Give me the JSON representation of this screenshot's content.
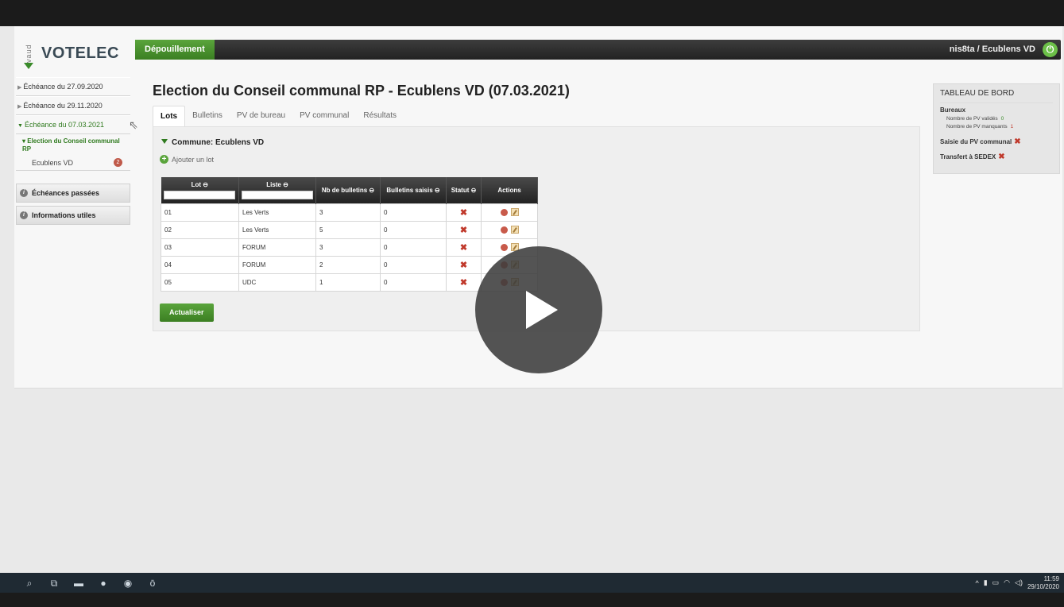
{
  "app": {
    "logo_text": "VOTELEC",
    "logo_sub": "vaud",
    "nav_tab": "Dépouillement",
    "user": "nis8ta  /  Ecublens VD",
    "power_icon": "power-icon"
  },
  "sidebar": {
    "echeances": [
      {
        "label": "Échéance du 27.09.2020"
      },
      {
        "label": "Échéance du 29.11.2020"
      },
      {
        "label": "Échéance du 07.03.2021"
      }
    ],
    "election": "Election du Conseil communal RP",
    "commune": "Ecublens VD",
    "commune_count": "2",
    "boxes": [
      {
        "label": "Échéances passées"
      },
      {
        "label": "Informations utiles"
      }
    ]
  },
  "main": {
    "title": "Election du Conseil communal RP - Ecublens VD (07.03.2021)",
    "tabs": [
      {
        "label": "Lots"
      },
      {
        "label": "Bulletins"
      },
      {
        "label": "PV de bureau"
      },
      {
        "label": "PV communal"
      },
      {
        "label": "Résultats"
      }
    ],
    "commune_header": "Commune: Ecublens VD",
    "add_lot": "Ajouter un lot",
    "table": {
      "columns": [
        "Lot ⊖",
        "Liste ⊖",
        "Nb de bulletins ⊖",
        "Bulletins saisis ⊖",
        "Statut ⊖",
        "Actions"
      ],
      "rows": [
        {
          "lot": "01",
          "liste": "Les Verts",
          "nb": "3",
          "saisis": "0"
        },
        {
          "lot": "02",
          "liste": "Les Verts",
          "nb": "5",
          "saisis": "0"
        },
        {
          "lot": "03",
          "liste": "FORUM",
          "nb": "3",
          "saisis": "0"
        },
        {
          "lot": "04",
          "liste": "FORUM",
          "nb": "2",
          "saisis": "0"
        },
        {
          "lot": "05",
          "liste": "UDC",
          "nb": "1",
          "saisis": "0"
        }
      ],
      "status_icon": "✖"
    },
    "refresh_button": "Actualiser"
  },
  "dashboard": {
    "title": "TABLEAU DE BORD",
    "bureaux": "Bureaux",
    "pv_valides_label": "Nombre de PV validés",
    "pv_valides_value": "0",
    "pv_manquants_label": "Nombre de PV manquants",
    "pv_manquants_value": "1",
    "saisie": "Saisie du PV communal",
    "transfert": "Transfert à SEDEX",
    "x_icon": "✖"
  },
  "taskbar": {
    "time": "11:59",
    "date": "29/10/2020"
  },
  "colors": {
    "accent_green": "#3b7f22",
    "error_red": "#c0392b",
    "topbar_dark": "#222222"
  }
}
